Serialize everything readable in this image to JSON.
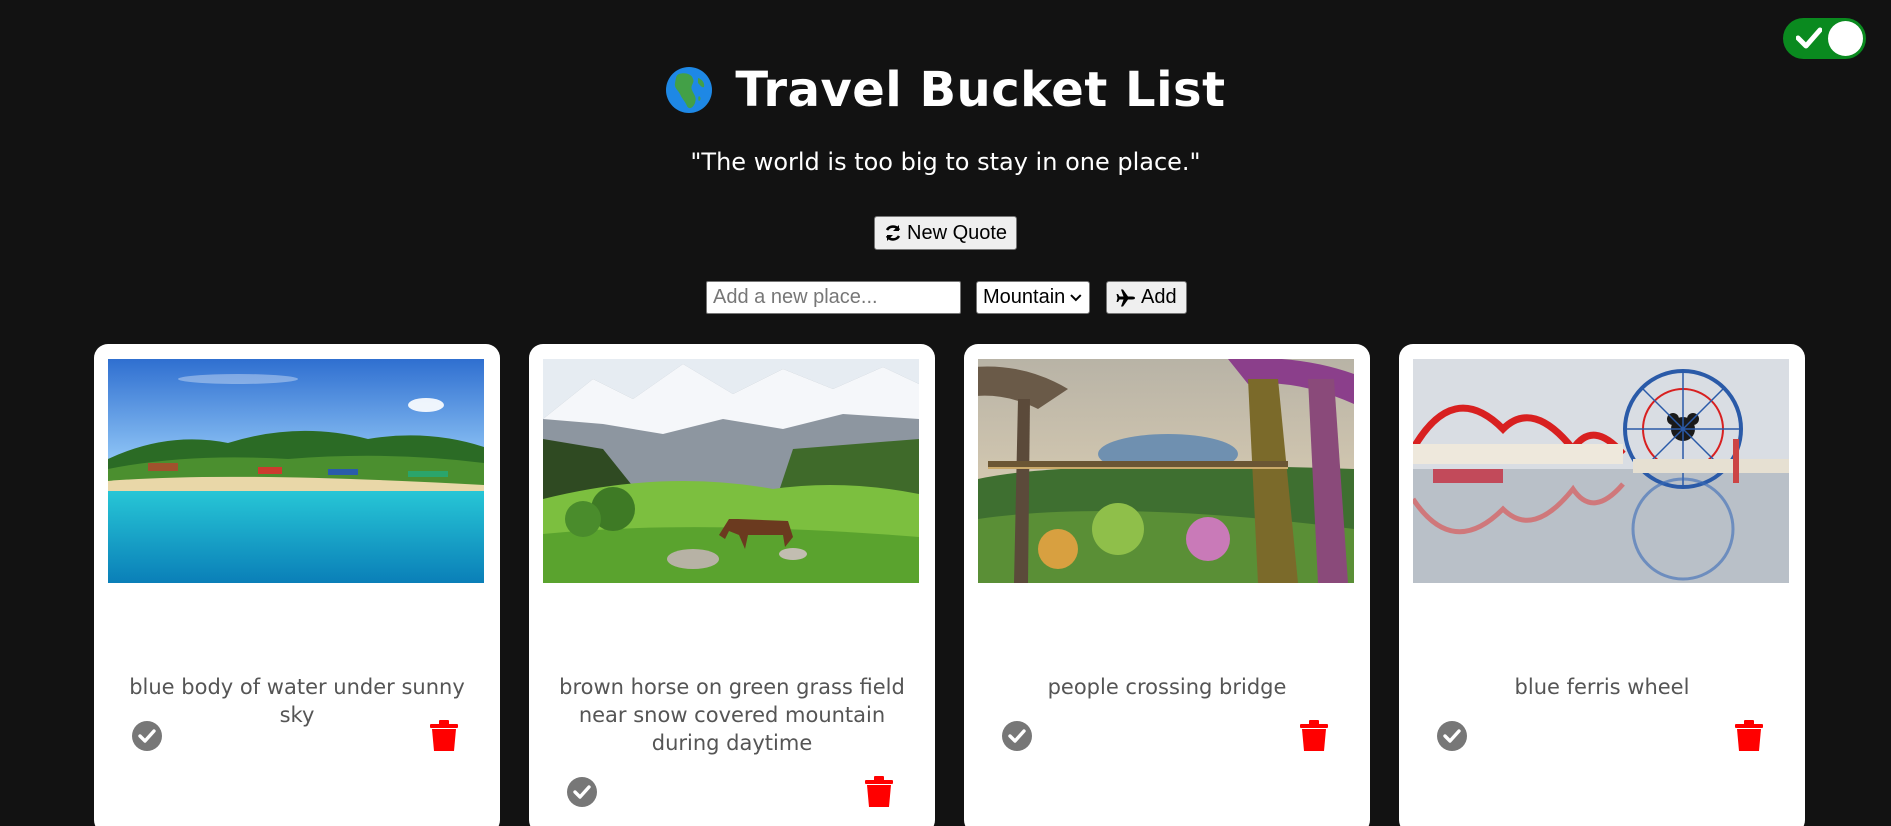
{
  "header": {
    "title": "Travel Bucket List",
    "quote": "\"The world is too big to stay in one place.\"",
    "new_quote_label": "New Quote",
    "globe_icon": "globe-africa-icon"
  },
  "form": {
    "place_placeholder": "Add a new place...",
    "category_selected": "Mountain",
    "add_label": "Add"
  },
  "theme_toggle": {
    "state": "on",
    "color": "#0a8a1f"
  },
  "cards": [
    {
      "caption": "blue body of water under sunny sky",
      "image": "tropical beach with turquoise water and palm trees"
    },
    {
      "caption": "brown horse on green grass field near snow covered mountain during daytime",
      "image": "horse grazing in green meadow below snowy mountains"
    },
    {
      "caption": "people crossing bridge",
      "image": "supertree grove skyway with gardens"
    },
    {
      "caption": "blue ferris wheel",
      "image": "ferris wheel and roller coaster reflected in water"
    }
  ],
  "colors": {
    "background": "#121212",
    "card": "#ffffff",
    "done": "#777777",
    "delete": "#ff0000"
  }
}
